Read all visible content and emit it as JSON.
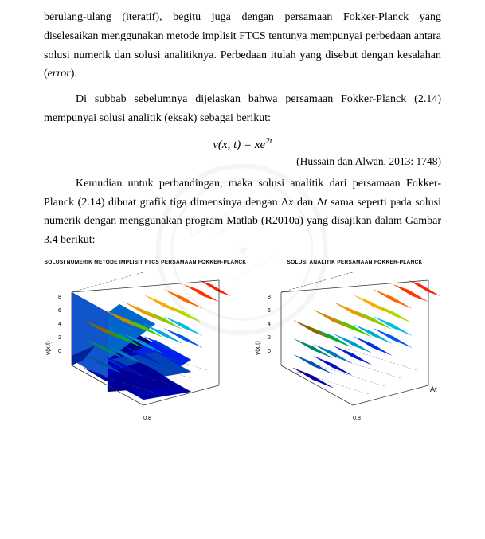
{
  "paragraphs": {
    "p1": "berulang-ulang (iteratif), begitu juga dengan persamaan Fokker-Planck yang diselesaikan menggunakan metode implisit FTCS tentunya mempunyai perbedaan antara solusi numerik dan solusi analitiknya. Perbedaan itulah yang disebut dengan kesalahan (",
    "p1_error": "error",
    "p1_end": ").",
    "p2_start": "Di subbab sebelumnya dijelaskan bahwa persamaan Fokker-Planck (2.14) mempunyai solusi analitik (eksak) sebagai berikut:",
    "formula": "v(x, t) = xe",
    "formula_exp": "2t",
    "citation": "(Hussain dan Alwan, 2013: 1748)",
    "p3": "Kemudian untuk perbandingan, maka solusi analitik dari persamaan Fokker-Planck (2.14) dibuat grafik tiga dimensinya dengan Δx dan Δt sama seperti pada solusi numerik dengan menggunakan program Matlab (R2010a) yang disajikan dalam Gambar 3.4 berikut:",
    "graph1_title": "SOLUSI NUMERIK METODE IMPLISIT FTCS PERSAMAAN FOKKER-PLANCK",
    "graph2_title": "SOLUSI ANALITIK PERSAMAAN FOKKER-PLANCK",
    "y_axis_label": "v(x,t)",
    "at_label": "At"
  }
}
